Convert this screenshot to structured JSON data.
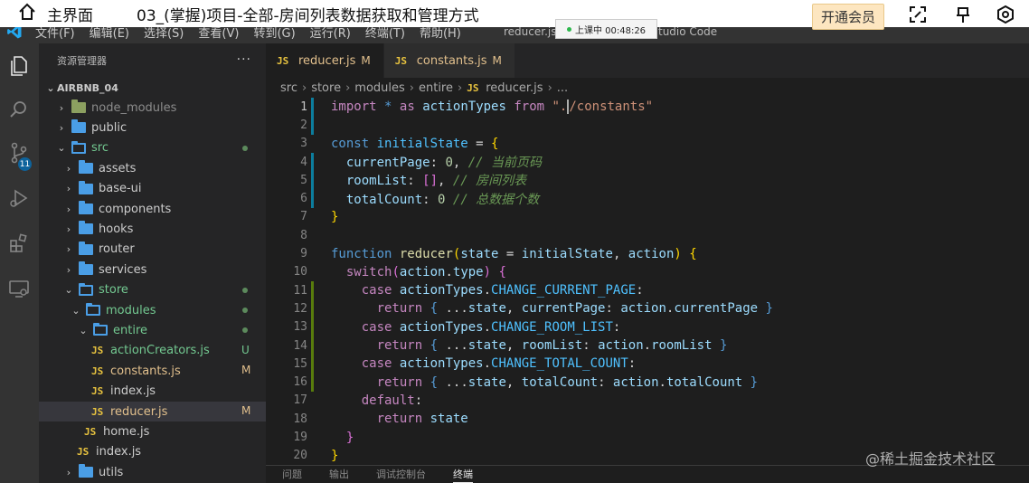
{
  "player": {
    "home_label": "主界面",
    "title": "03_(掌握)项目-全部-房间列表数据获取和管理方式",
    "vip_label": "开通会员",
    "class_status": "上课中 00:48:26"
  },
  "menubar": {
    "items": [
      "文件(F)",
      "编辑(E)",
      "选择(S)",
      "查看(V)",
      "转到(G)",
      "运行(R)",
      "终端(T)",
      "帮助(H)"
    ],
    "window_title": "reducer.js",
    "window_title_tail": "tudio Code"
  },
  "activity": {
    "scm_badge": "11"
  },
  "sidebar": {
    "header": "资源管理器",
    "more": "···",
    "project": "AIRBNB_04",
    "tree": [
      {
        "label": "node_modules",
        "kind": "folder-nm",
        "depth": 1,
        "chev": "›",
        "status": "ignored"
      },
      {
        "label": "public",
        "kind": "folder",
        "depth": 1,
        "chev": "›",
        "status": ""
      },
      {
        "label": "src",
        "kind": "folder-open",
        "depth": 1,
        "chev": "⌄",
        "status": "untracked",
        "dot": true
      },
      {
        "label": "assets",
        "kind": "folder",
        "depth": 2,
        "chev": "›",
        "status": ""
      },
      {
        "label": "base-ui",
        "kind": "folder",
        "depth": 2,
        "chev": "›",
        "status": ""
      },
      {
        "label": "components",
        "kind": "folder",
        "depth": 2,
        "chev": "›",
        "status": ""
      },
      {
        "label": "hooks",
        "kind": "folder",
        "depth": 2,
        "chev": "›",
        "status": ""
      },
      {
        "label": "router",
        "kind": "folder",
        "depth": 2,
        "chev": "›",
        "status": ""
      },
      {
        "label": "services",
        "kind": "folder",
        "depth": 2,
        "chev": "›",
        "status": ""
      },
      {
        "label": "store",
        "kind": "folder-open",
        "depth": 2,
        "chev": "⌄",
        "status": "untracked",
        "dot": true
      },
      {
        "label": "modules",
        "kind": "folder-open",
        "depth": 3,
        "chev": "⌄",
        "status": "untracked",
        "dot": true
      },
      {
        "label": "entire",
        "kind": "folder-open",
        "depth": 4,
        "chev": "⌄",
        "status": "untracked",
        "dot": true
      },
      {
        "label": "actionCreators.js",
        "kind": "js",
        "depth": 5,
        "chev": "",
        "status": "untracked",
        "letter": "U"
      },
      {
        "label": "constants.js",
        "kind": "js",
        "depth": 5,
        "chev": "",
        "status": "modified",
        "letter": "M"
      },
      {
        "label": "index.js",
        "kind": "js",
        "depth": 5,
        "chev": "",
        "status": ""
      },
      {
        "label": "reducer.js",
        "kind": "js",
        "depth": 5,
        "chev": "",
        "status": "modified",
        "letter": "M",
        "selected": true
      },
      {
        "label": "home.js",
        "kind": "js",
        "depth": 4,
        "chev": "",
        "status": ""
      },
      {
        "label": "index.js",
        "kind": "js",
        "depth": 3,
        "chev": "",
        "status": ""
      },
      {
        "label": "utils",
        "kind": "folder",
        "depth": 2,
        "chev": "›",
        "status": ""
      }
    ]
  },
  "editor": {
    "tabs": [
      {
        "label": "reducer.js",
        "badge": "M",
        "active": true
      },
      {
        "label": "constants.js",
        "badge": "M",
        "active": false
      }
    ],
    "breadcrumb": [
      "src",
      "store",
      "modules",
      "entire",
      "reducer.js",
      "..."
    ],
    "code": [
      [
        [
          "k",
          "import"
        ],
        [
          "p",
          " "
        ],
        [
          "kb",
          "*"
        ],
        [
          "p",
          " "
        ],
        [
          "k",
          "as"
        ],
        [
          "p",
          " "
        ],
        [
          "v",
          "actionTypes"
        ],
        [
          "p",
          " "
        ],
        [
          "k",
          "from"
        ],
        [
          "p",
          " "
        ],
        [
          "s",
          "\"."
        ],
        [
          "cursor",
          ""
        ],
        [
          "s",
          "/constants\""
        ]
      ],
      [],
      [
        [
          "kb",
          "const"
        ],
        [
          "p",
          " "
        ],
        [
          "cst",
          "initialState"
        ],
        [
          "p",
          " = "
        ],
        [
          "y",
          "{"
        ]
      ],
      [
        [
          "p",
          "  "
        ],
        [
          "v",
          "currentPage"
        ],
        [
          "p",
          ": "
        ],
        [
          "n",
          "0"
        ],
        [
          "p",
          ", "
        ],
        [
          "c",
          "// 当前页码"
        ]
      ],
      [
        [
          "p",
          "  "
        ],
        [
          "v",
          "roomList"
        ],
        [
          "p",
          ": "
        ],
        [
          "pk",
          "[]"
        ],
        [
          "p",
          ", "
        ],
        [
          "c",
          "// 房间列表"
        ]
      ],
      [
        [
          "p",
          "  "
        ],
        [
          "v",
          "totalCount"
        ],
        [
          "p",
          ": "
        ],
        [
          "n",
          "0"
        ],
        [
          "p",
          " "
        ],
        [
          "c",
          "// 总数据个数"
        ]
      ],
      [
        [
          "y",
          "}"
        ]
      ],
      [],
      [
        [
          "kb",
          "function"
        ],
        [
          "p",
          " "
        ],
        [
          "f",
          "reducer"
        ],
        [
          "y",
          "("
        ],
        [
          "v",
          "state"
        ],
        [
          "p",
          " = "
        ],
        [
          "v",
          "initialState"
        ],
        [
          "p",
          ", "
        ],
        [
          "v",
          "action"
        ],
        [
          "y",
          ")"
        ],
        [
          "p",
          " "
        ],
        [
          "y",
          "{"
        ]
      ],
      [
        [
          "p",
          "  "
        ],
        [
          "k",
          "switch"
        ],
        [
          "pk",
          "("
        ],
        [
          "v",
          "action"
        ],
        [
          "p",
          "."
        ],
        [
          "v",
          "type"
        ],
        [
          "pk",
          ")"
        ],
        [
          "p",
          " "
        ],
        [
          "pk",
          "{"
        ]
      ],
      [
        [
          "p",
          "    "
        ],
        [
          "k",
          "case"
        ],
        [
          "p",
          " "
        ],
        [
          "v",
          "actionTypes"
        ],
        [
          "p",
          "."
        ],
        [
          "cst",
          "CHANGE_CURRENT_PAGE"
        ],
        [
          "p",
          ":"
        ]
      ],
      [
        [
          "p",
          "      "
        ],
        [
          "k",
          "return"
        ],
        [
          "p",
          " "
        ],
        [
          "kb",
          "{"
        ],
        [
          "p",
          " ..."
        ],
        [
          "v",
          "state"
        ],
        [
          "p",
          ", "
        ],
        [
          "v",
          "currentPage"
        ],
        [
          "p",
          ": "
        ],
        [
          "v",
          "action"
        ],
        [
          "p",
          "."
        ],
        [
          "v",
          "currentPage"
        ],
        [
          "p",
          " "
        ],
        [
          "kb",
          "}"
        ]
      ],
      [
        [
          "p",
          "    "
        ],
        [
          "k",
          "case"
        ],
        [
          "p",
          " "
        ],
        [
          "v",
          "actionTypes"
        ],
        [
          "p",
          "."
        ],
        [
          "cst",
          "CHANGE_ROOM_LIST"
        ],
        [
          "p",
          ":"
        ]
      ],
      [
        [
          "p",
          "      "
        ],
        [
          "k",
          "return"
        ],
        [
          "p",
          " "
        ],
        [
          "kb",
          "{"
        ],
        [
          "p",
          " ..."
        ],
        [
          "v",
          "state"
        ],
        [
          "p",
          ", "
        ],
        [
          "v",
          "roomList"
        ],
        [
          "p",
          ": "
        ],
        [
          "v",
          "action"
        ],
        [
          "p",
          "."
        ],
        [
          "v",
          "roomList"
        ],
        [
          "p",
          " "
        ],
        [
          "kb",
          "}"
        ]
      ],
      [
        [
          "p",
          "    "
        ],
        [
          "k",
          "case"
        ],
        [
          "p",
          " "
        ],
        [
          "v",
          "actionTypes"
        ],
        [
          "p",
          "."
        ],
        [
          "cst",
          "CHANGE_TOTAL_COUNT"
        ],
        [
          "p",
          ":"
        ]
      ],
      [
        [
          "p",
          "      "
        ],
        [
          "k",
          "return"
        ],
        [
          "p",
          " "
        ],
        [
          "kb",
          "{"
        ],
        [
          "p",
          " ..."
        ],
        [
          "v",
          "state"
        ],
        [
          "p",
          ", "
        ],
        [
          "v",
          "totalCount"
        ],
        [
          "p",
          ": "
        ],
        [
          "v",
          "action"
        ],
        [
          "p",
          "."
        ],
        [
          "v",
          "totalCount"
        ],
        [
          "p",
          " "
        ],
        [
          "kb",
          "}"
        ]
      ],
      [
        [
          "p",
          "    "
        ],
        [
          "k",
          "default"
        ],
        [
          "p",
          ":"
        ]
      ],
      [
        [
          "p",
          "      "
        ],
        [
          "k",
          "return"
        ],
        [
          "p",
          " "
        ],
        [
          "v",
          "state"
        ]
      ],
      [
        [
          "p",
          "  "
        ],
        [
          "pk",
          "}"
        ]
      ],
      [
        [
          "y",
          "}"
        ]
      ]
    ],
    "current_line": 1,
    "panel_tabs": [
      "问题",
      "输出",
      "调试控制台",
      "终端"
    ],
    "panel_active": 3
  },
  "watermark": "@稀土掘金技术社区"
}
